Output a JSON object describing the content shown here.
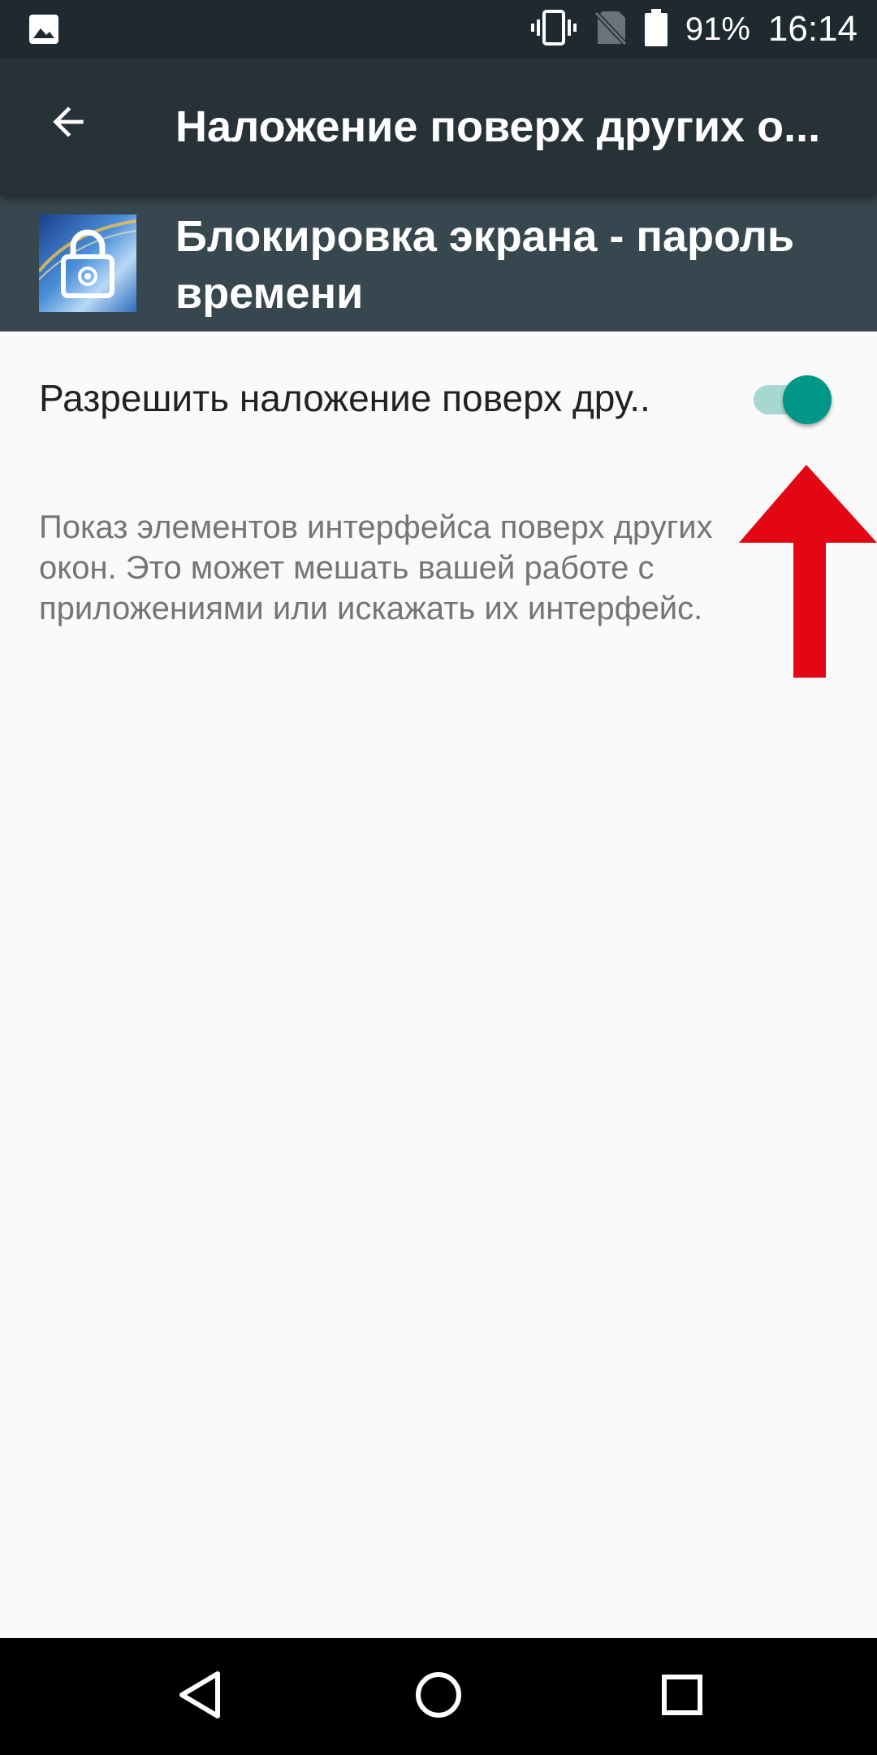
{
  "status_bar": {
    "battery": "91%",
    "time": "16:14",
    "icons": [
      "image-notification-icon",
      "vibrate-icon",
      "no-sim-icon",
      "battery-icon"
    ]
  },
  "app_bar": {
    "title": "Наложение поверх других о...",
    "back_icon": "arrow-back-icon"
  },
  "app_header": {
    "name": "Блокировка экрана - пароль времени",
    "icon": "lock-app-icon"
  },
  "setting": {
    "title": "Разрешить наложение поверх дру..",
    "enabled": true,
    "summary": "Показ элементов интерфейса поверх других окон. Это может мешать вашей работе с приложениями или искажать их интерфейс."
  },
  "annotation": {
    "arrow_color": "#e30613"
  },
  "colors": {
    "status_bar": "#1f2a30",
    "app_bar": "#263238",
    "app_header": "#37474f",
    "accent": "#009688",
    "background": "#fafafa"
  },
  "nav_bar": {
    "icons": [
      "back-triangle-icon",
      "home-circle-icon",
      "recents-square-icon"
    ]
  }
}
